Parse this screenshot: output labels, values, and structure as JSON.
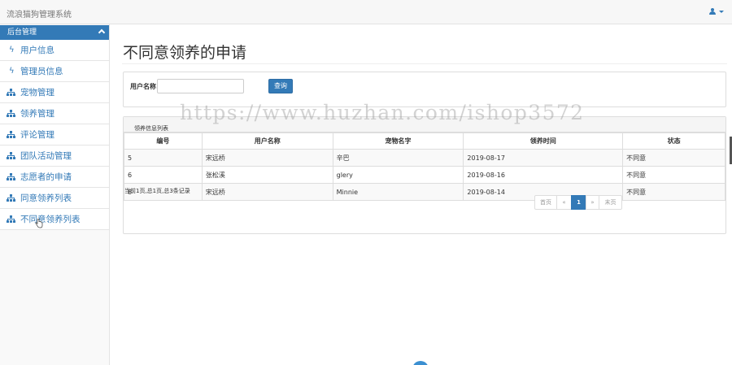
{
  "app": {
    "brand": "流浪猫狗管理系统"
  },
  "sidebar": {
    "header": "后台管理",
    "items": [
      {
        "label": "用户信息",
        "icon": "bolt-icon"
      },
      {
        "label": "管理员信息",
        "icon": "bolt-icon"
      },
      {
        "label": "宠物管理",
        "icon": "sitemap-icon"
      },
      {
        "label": "领养管理",
        "icon": "sitemap-icon"
      },
      {
        "label": "评论管理",
        "icon": "sitemap-icon"
      },
      {
        "label": "团队活动管理",
        "icon": "sitemap-icon"
      },
      {
        "label": "志愿者的申请",
        "icon": "sitemap-icon"
      },
      {
        "label": "同意领养列表",
        "icon": "sitemap-icon"
      },
      {
        "label": "不同意领养列表",
        "icon": "sitemap-icon"
      }
    ]
  },
  "main": {
    "title": "不同意领养的申请",
    "search": {
      "label": "用户名称",
      "value": "",
      "button": "查询"
    },
    "list": {
      "heading": "领养信息列表",
      "columns": [
        "编号",
        "用户名称",
        "宠物名字",
        "领养时间",
        "状态"
      ],
      "rows": [
        [
          "5",
          "宋远桥",
          "辛巴",
          "2019-08-17",
          "不同意"
        ],
        [
          "6",
          "张松溪",
          "glery",
          "2019-08-16",
          "不同意"
        ],
        [
          "8",
          "宋远桥",
          "Minnie",
          "2019-08-14",
          "不同意"
        ]
      ],
      "page_info": "当前1页,总1页,总3条记录",
      "pager": {
        "first": "首页",
        "prev": "«",
        "current": "1",
        "next": "»",
        "last": "末页"
      }
    }
  },
  "watermark": "https://www.huzhan.com/ishop3572",
  "colors": {
    "primary": "#337ab7",
    "border": "#dddddd"
  }
}
